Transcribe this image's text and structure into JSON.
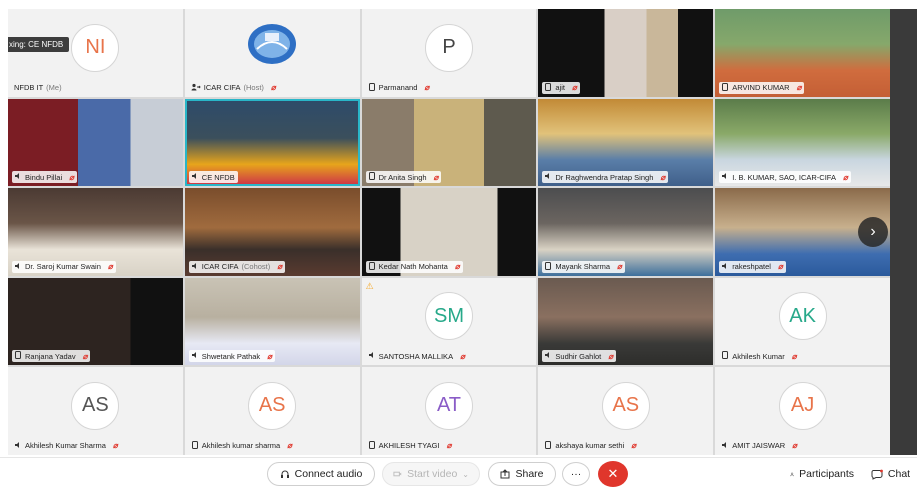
{
  "speaking_indicator": "xing: CE NFDB",
  "participants": [
    {
      "name": "NFDB IT",
      "suffix": "(Me)",
      "initials": "NI",
      "kind": "avatar",
      "initials_color": "#e8744a",
      "mic_muted": false,
      "icon": "none"
    },
    {
      "name": "ICAR CIFA",
      "suffix": "(Host)",
      "kind": "logo",
      "mic_muted": true,
      "icon": "person-share-icon"
    },
    {
      "name": "Parmanand",
      "suffix": "",
      "initials": "P",
      "kind": "avatar",
      "initials_color": "#444444",
      "mic_muted": true,
      "icon": "phone-icon"
    },
    {
      "name": "ajit",
      "suffix": "",
      "kind": "video",
      "mic_muted": true,
      "icon": "phone-icon"
    },
    {
      "name": "ARVIND KUMAR",
      "suffix": "",
      "kind": "video",
      "mic_muted": true,
      "icon": "phone-icon"
    },
    {
      "name": "Bindu Pillai",
      "suffix": "",
      "kind": "video",
      "mic_muted": true,
      "icon": "audio-icon"
    },
    {
      "name": "CE NFDB",
      "suffix": "",
      "kind": "video",
      "mic_muted": false,
      "active": true,
      "icon": "audio-icon"
    },
    {
      "name": "Dr Anita Singh",
      "suffix": "",
      "kind": "video",
      "mic_muted": true,
      "icon": "phone-icon"
    },
    {
      "name": "Dr Raghwendra Pratap Singh",
      "suffix": "",
      "kind": "video",
      "mic_muted": true,
      "icon": "audio-icon"
    },
    {
      "name": "I. B. KUMAR, SAO, ICAR-CIFA",
      "suffix": "",
      "kind": "video",
      "mic_muted": true,
      "icon": "audio-icon"
    },
    {
      "name": "Dr. Saroj Kumar Swain",
      "suffix": "",
      "kind": "video",
      "mic_muted": true,
      "icon": "audio-icon"
    },
    {
      "name": "ICAR CIFA",
      "suffix": "(Cohost)",
      "kind": "video",
      "mic_muted": true,
      "icon": "audio-icon"
    },
    {
      "name": "Kedar Nath Mohanta",
      "suffix": "",
      "kind": "video",
      "mic_muted": true,
      "icon": "phone-icon"
    },
    {
      "name": "Mayank Sharma",
      "suffix": "",
      "kind": "video",
      "mic_muted": true,
      "icon": "phone-icon"
    },
    {
      "name": "rakeshpatel",
      "suffix": "",
      "kind": "video",
      "mic_muted": true,
      "icon": "audio-icon"
    },
    {
      "name": "Ranjana Yadav",
      "suffix": "",
      "kind": "video",
      "mic_muted": true,
      "icon": "phone-icon"
    },
    {
      "name": "Shwetank Pathak",
      "suffix": "",
      "kind": "video",
      "mic_muted": true,
      "icon": "audio-icon"
    },
    {
      "name": "SANTOSHA MALLIKA",
      "suffix": "",
      "initials": "SM",
      "kind": "avatar",
      "initials_color": "#27a98a",
      "mic_muted": true,
      "icon": "audio-icon",
      "warning": true
    },
    {
      "name": "Sudhir Gahlot",
      "suffix": "",
      "kind": "video",
      "mic_muted": true,
      "icon": "audio-icon"
    },
    {
      "name": "Akhilesh Kumar",
      "suffix": "",
      "initials": "AK",
      "kind": "avatar",
      "initials_color": "#27a98a",
      "mic_muted": true,
      "icon": "phone-icon"
    },
    {
      "name": "Akhilesh Kumar Sharma",
      "suffix": "",
      "initials": "AS",
      "kind": "avatar",
      "initials_color": "#555555",
      "mic_muted": true,
      "icon": "audio-icon"
    },
    {
      "name": "Akhilesh kumar sharma",
      "suffix": "",
      "initials": "AS",
      "kind": "avatar",
      "initials_color": "#e8744a",
      "mic_muted": true,
      "icon": "phone-icon"
    },
    {
      "name": "AKHILESH TYAGI",
      "suffix": "",
      "initials": "AT",
      "kind": "avatar",
      "initials_color": "#8a5cc7",
      "mic_muted": true,
      "icon": "phone-icon"
    },
    {
      "name": "akshaya kumar sethi",
      "suffix": "",
      "initials": "AS",
      "kind": "avatar",
      "initials_color": "#e8744a",
      "mic_muted": true,
      "icon": "phone-icon"
    },
    {
      "name": "AMIT JAISWAR",
      "suffix": "",
      "initials": "AJ",
      "kind": "avatar",
      "initials_color": "#e8744a",
      "mic_muted": true,
      "icon": "audio-icon"
    }
  ],
  "toolbar": {
    "connect_audio": "Connect audio",
    "start_video": "Start video",
    "share": "Share",
    "more": "···",
    "leave": "✕",
    "participants": "Participants",
    "chat": "Chat"
  },
  "colors": {
    "active_border": "#29b6c8",
    "leave_red": "#e0362c",
    "mic_muted_red": "#e0362c"
  }
}
